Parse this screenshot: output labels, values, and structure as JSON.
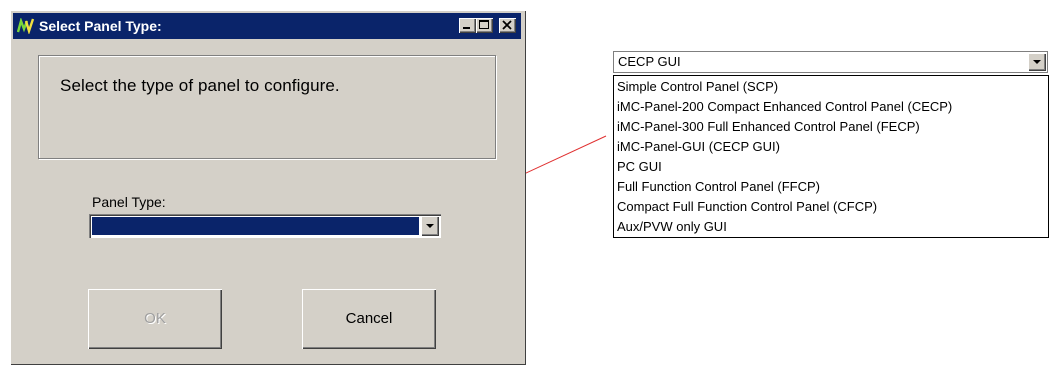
{
  "dialog": {
    "title": "Select Panel Type:",
    "message": "Select the type of panel to configure.",
    "panel_type_label": "Panel Type:",
    "ok_label": "OK",
    "cancel_label": "Cancel",
    "ok_enabled": false
  },
  "dropdown": {
    "selected_value": "CECP GUI",
    "options": [
      "Simple Control Panel (SCP)",
      "iMC-Panel-200 Compact Enhanced Control Panel (CECP)",
      "iMC-Panel-300 Full Enhanced Control Panel (FECP)",
      "iMC-Panel-GUI (CECP GUI)",
      "PC GUI",
      "Full Function Control Panel (FFCP)",
      "Compact Full Function Control Panel (CFCP)",
      "Aux/PVW only GUI"
    ]
  },
  "icons": {
    "app_logo": "nv-logo-icon",
    "minimize": "minimize-icon",
    "maximize": "maximize-icon",
    "close": "close-icon",
    "dropdown_arrow": "chevron-down-icon"
  },
  "colors": {
    "titlebar": "#0a246a",
    "dialog_face": "#d4d0c8",
    "selection": "#0a246a",
    "connector": "#e03030"
  }
}
